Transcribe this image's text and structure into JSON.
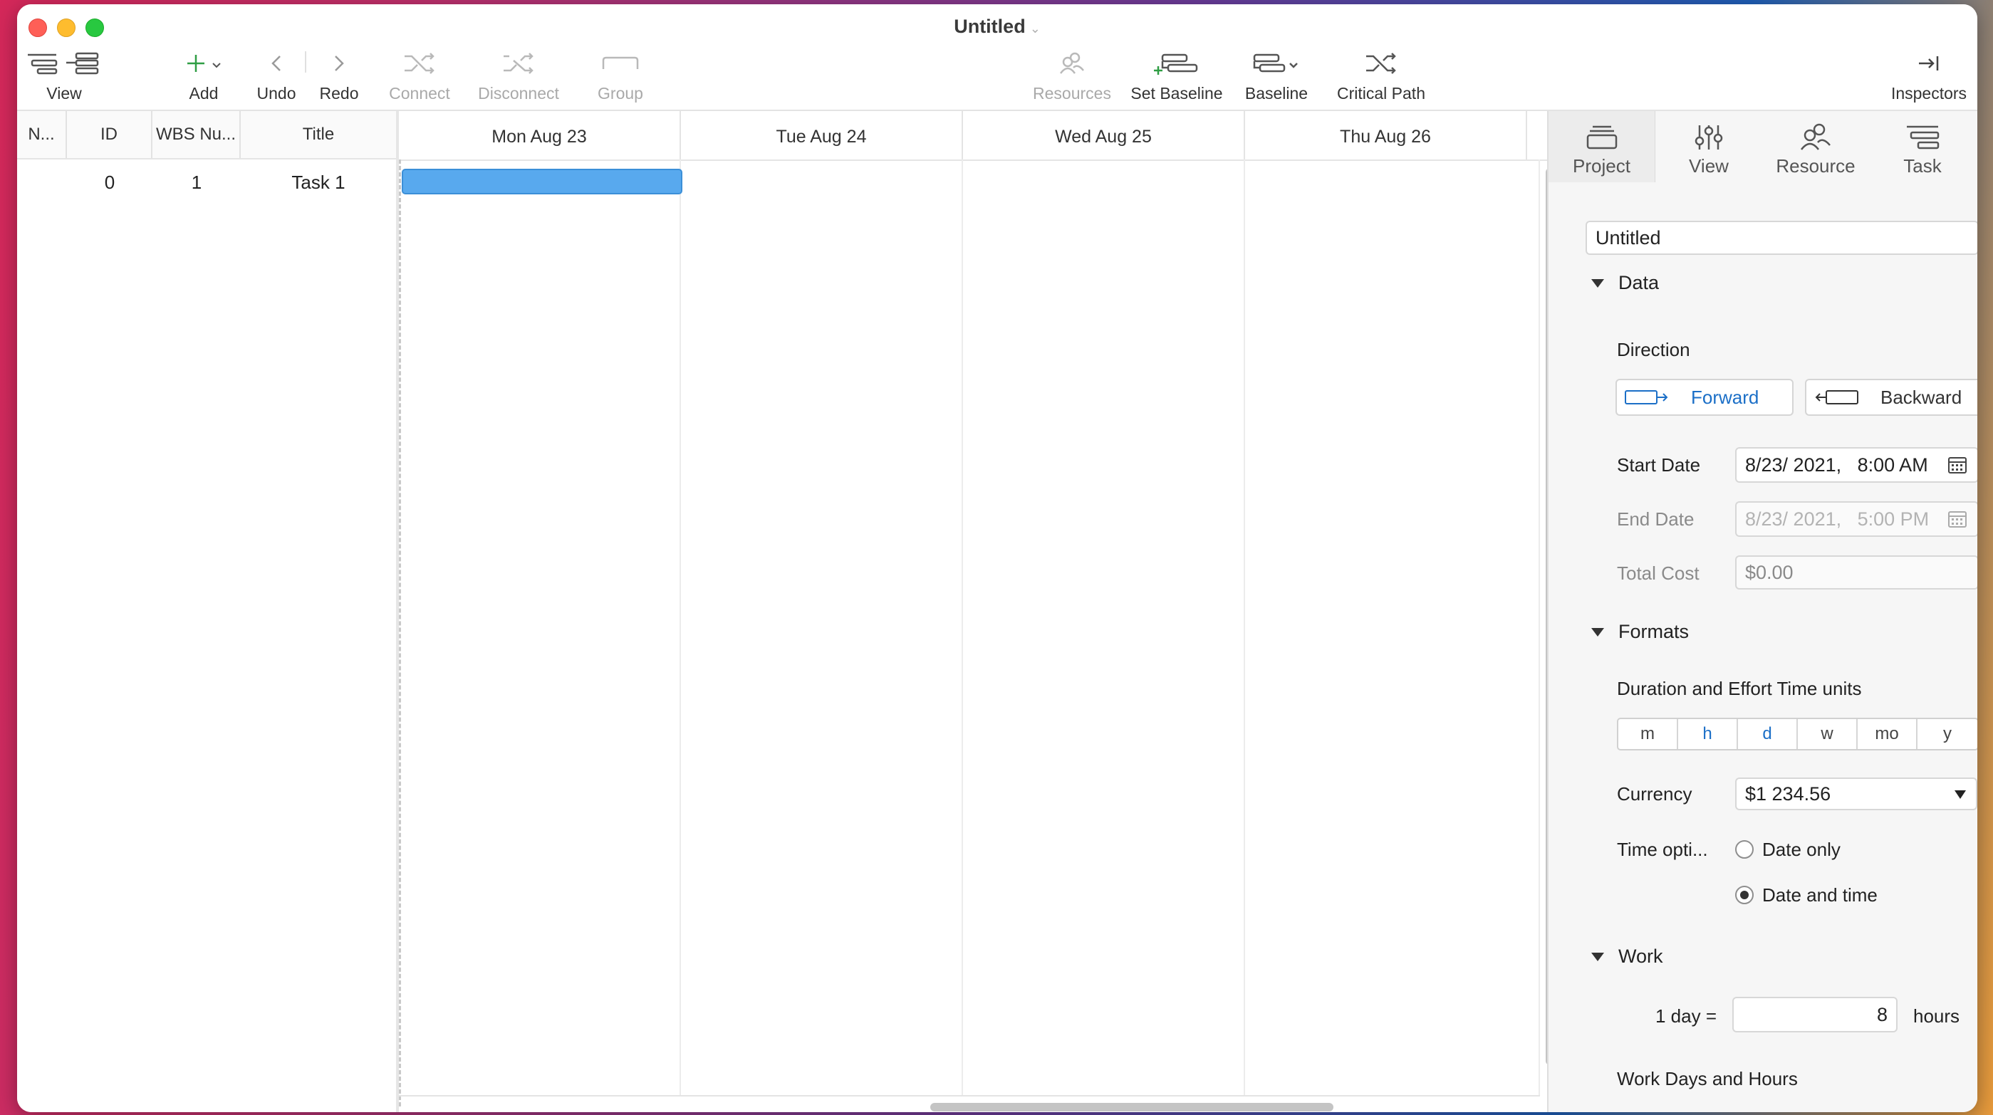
{
  "window": {
    "title": "Untitled"
  },
  "toolbar": {
    "view": "View",
    "add": "Add",
    "undo": "Undo",
    "redo": "Redo",
    "connect": "Connect",
    "disconnect": "Disconnect",
    "group": "Group",
    "resources": "Resources",
    "set_baseline": "Set Baseline",
    "baseline": "Baseline",
    "critical_path": "Critical Path",
    "inspectors": "Inspectors"
  },
  "table": {
    "columns": [
      "N...",
      "ID",
      "WBS Nu...",
      "Title"
    ],
    "rows": [
      {
        "n": "",
        "id": "0",
        "wbs": "1",
        "title": "Task 1"
      }
    ]
  },
  "gantt": {
    "days": [
      "Mon Aug 23",
      "Tue Aug 24",
      "Wed Aug 25",
      "Thu Aug 26"
    ],
    "task_bar_color": "#58a9ee"
  },
  "inspector": {
    "tabs": [
      "Project",
      "View",
      "Resource",
      "Task"
    ],
    "active_tab": "Project",
    "project_name": "Untitled",
    "data_section": "Data",
    "direction_label": "Direction",
    "forward": "Forward",
    "backward": "Backward",
    "start_date_label": "Start Date",
    "start_date_value": "8/23/ 2021,   8:00 AM",
    "end_date_label": "End Date",
    "end_date_value": "8/23/ 2021,   5:00 PM",
    "total_cost_label": "Total Cost",
    "total_cost_value": "$0.00",
    "formats_section": "Formats",
    "duration_units_label": "Duration and Effort Time units",
    "time_units": [
      "m",
      "h",
      "d",
      "w",
      "mo",
      "y"
    ],
    "time_units_selected": [
      "h",
      "d"
    ],
    "currency_label": "Currency",
    "currency_value": "$1 234.56",
    "time_options_label": "Time opti...",
    "date_only": "Date only",
    "date_and_time": "Date and time",
    "time_option_selected": "Date and time",
    "work_section": "Work",
    "one_day_label": "1 day =",
    "hours_per_day": "8",
    "hours_label": "hours",
    "work_days_label": "Work Days and Hours"
  },
  "colors": {
    "accent": "#1b6fc7",
    "task_bar": "#58a9ee"
  }
}
